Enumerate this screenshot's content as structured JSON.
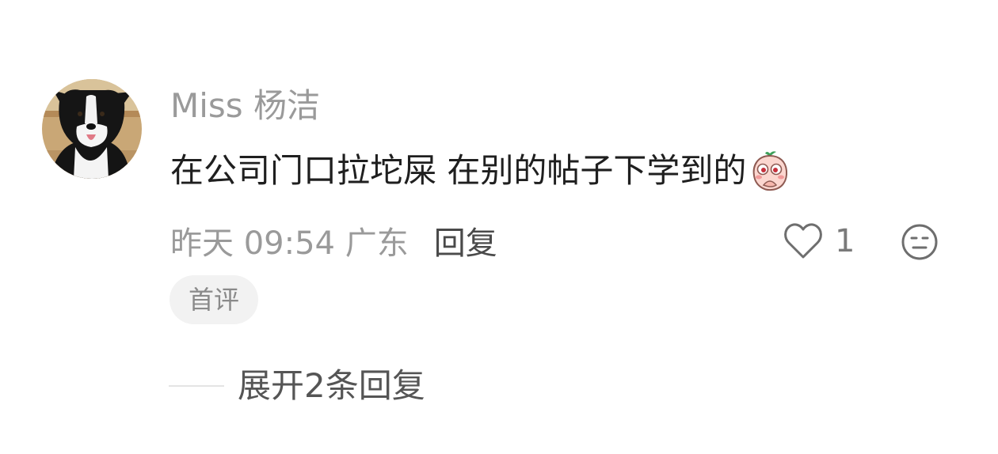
{
  "comment": {
    "username": "Miss 杨洁",
    "text": "在公司门口拉坨屎 在别的帖子下学到的",
    "time_location": "昨天 09:54 广东",
    "reply_label": "回复",
    "like_count": "1",
    "badge": "首评",
    "expand_label": "展开2条回复",
    "avatar_icon": "border-collie-dog-avatar",
    "emoji_icon": "blushing-peach-emoji"
  },
  "colors": {
    "username": "#9a9a9a",
    "text": "#1f1f1f",
    "meta": "#9a9a9a",
    "reply": "#4a4a4a",
    "badge_bg": "#f2f2f2"
  }
}
